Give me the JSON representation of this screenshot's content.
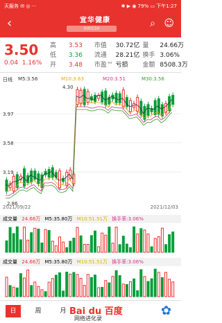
{
  "status": {
    "left": "天服务 ✉ ◎ ···",
    "right": "✱ ▶ ◉ 79% ▭ 下午1:27"
  },
  "header": {
    "title": "宜华健康",
    "subtitle": "000150",
    "back": "‹",
    "icons": [
      "search-icon",
      "share-icon"
    ]
  },
  "quote": {
    "price": "3.50",
    "change": "0.04",
    "change_pct": "1.16%",
    "rows": [
      {
        "l1": "高",
        "v1": "3.53",
        "l2": "市值",
        "v2": "30.72亿",
        "l3": "量",
        "v3": "24.66万",
        "c": "red"
      },
      {
        "l1": "低",
        "v1": "3.36",
        "l2": "流通",
        "v2": "28.21亿",
        "l3": "换手",
        "v3": "3.06%",
        "c": "green"
      },
      {
        "l1": "开",
        "v1": "3.48",
        "l2": "市盈™",
        "v2": "亏损",
        "l3": "金额",
        "v3": "8508.3万",
        "c": "red"
      }
    ]
  },
  "legend": {
    "day": "日线",
    "m5": "M5:3.56",
    "m10": "M10:3.63",
    "m20": "M20:3.51",
    "m30": "M30:3.56"
  },
  "axis": {
    "y_top": "4.30",
    "y1": "3.97",
    "y2": "3.58",
    "y3": "3.19",
    "y_low": "2.86",
    "date_left": "2021/09/22",
    "date_right": "2021/12/03"
  },
  "vol1": {
    "label": "成交量",
    "vol": "24.66万",
    "m5": "M5:35.80万",
    "m10": "M10:51.51万",
    "turn": "换手率:3.06%"
  },
  "vol2": {
    "label": "成交量",
    "vol": "24.66万",
    "m5": "M5:35.80万",
    "m10": "M10:51.51万",
    "turn": "换手率:3.06%"
  },
  "tabs": {
    "day": "日",
    "week": "周",
    "month": "月"
  },
  "brand": {
    "name": "Bai du 百度",
    "sub": "网络进化录"
  },
  "colors": {
    "up": "#e8322e",
    "down": "#0a9e3a",
    "m5": "#333333",
    "m10": "#e5a800",
    "m20": "#d63384",
    "m30": "#3a9b2e"
  }
}
